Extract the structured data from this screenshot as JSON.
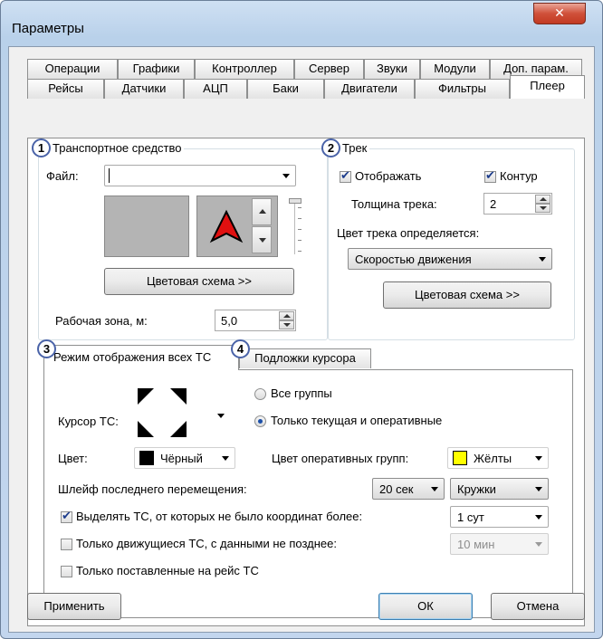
{
  "window": {
    "title": "Параметры",
    "close_icon": "✕"
  },
  "tabs_row1": [
    "Операции",
    "Графики",
    "Контроллер",
    "Сервер",
    "Звуки",
    "Модули",
    "Доп. парам."
  ],
  "tabs_row2": [
    "Рейсы",
    "Датчики",
    "АЦП",
    "Баки",
    "Двигатели",
    "Фильтры",
    "Плеер"
  ],
  "active_tab": "Плеер",
  "vehicle": {
    "number": "1",
    "title": "Транспортное средство",
    "file_label": "Файл:",
    "file_value": "",
    "color_scheme_button": "Цветовая схема >>",
    "work_zone_label": "Рабочая зона, м:",
    "work_zone_value": "5,0"
  },
  "track": {
    "number": "2",
    "title": "Трек",
    "show_label": "Отображать",
    "show_checked": true,
    "contour_label": "Контур",
    "contour_checked": true,
    "thickness_label": "Толщина трека:",
    "thickness_value": "2",
    "color_by_label": "Цвет трека определяется:",
    "color_by_value": "Скоростью движения",
    "color_scheme_button": "Цветовая схема >>"
  },
  "subtabs": {
    "tab3_number": "3",
    "tab3_label": "Режим отображения всех ТС",
    "tab4_number": "4",
    "tab4_label": "Подложки курсора"
  },
  "display_mode": {
    "cursor_label": "Курсор ТС:",
    "all_groups_label": "Все группы",
    "current_groups_label": "Только текущая и оперативные",
    "selected_radio": "current",
    "color_label": "Цвет:",
    "color_value": "Чёрный",
    "color_hex": "#000000",
    "op_groups_label": "Цвет оперативных групп:",
    "op_color_value": "Жёлты",
    "op_color_hex": "#ffff00",
    "trail_label": "Шлейф последнего перемещения:",
    "trail_time_value": "20 сек",
    "trail_style_value": "Кружки",
    "highlight_label": "Выделять ТС, от которых не было координат более:",
    "highlight_checked": true,
    "highlight_value": "1 сут",
    "moving_only_label": "Только движущиеся ТС, с данными не позднее:",
    "moving_only_checked": false,
    "moving_only_value": "10 мин",
    "on_trip_label": "Только поставленные на рейс ТС",
    "on_trip_checked": false
  },
  "footer": {
    "apply_button": "Применить",
    "ok_button": "ОК",
    "cancel_button": "Отмена"
  }
}
